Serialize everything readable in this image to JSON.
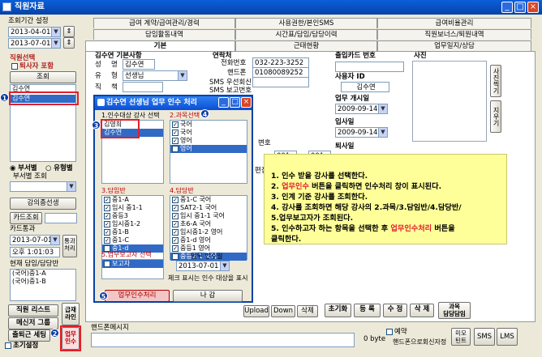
{
  "window": {
    "title": "직원자료",
    "controls": [
      "_",
      "□",
      "×"
    ]
  },
  "left": {
    "period_label": "조회기간 설정",
    "date_from": "2013-04-01",
    "date_to": "2013-07-01",
    "staff_select_label": "직원선택",
    "retired_label": "퇴사자 포함",
    "search_button": "조회",
    "names": [
      "김수연",
      "김수연"
    ],
    "radio_dept": "부서별",
    "radio_type": "유형별",
    "dept_search_label": "부서별 조회",
    "lecture_teacher_button": "강의종선생",
    "card_search_button": "카드조회",
    "card_pass_label": "카드통과",
    "card_date": "2013-07-01",
    "card_time": "오후 1:01:03",
    "pass_button": "통과처리",
    "current_class_label": "현재 담임/담당반",
    "current_classes": [
      "(국어)중1-A",
      "(국어)중1-B"
    ],
    "staff_list_button": "직원 리스트",
    "messenger_button": "메신저 그룹",
    "attendance_button": "출퇴근 세팅",
    "retirement_checkbox": "초기설정",
    "payroll_button": "급재라인",
    "handover_button": "업무인수"
  },
  "tabs": {
    "row1": [
      "급여 계약/급여관리/경력",
      "사용권한/본인SMS",
      "급여비율관리"
    ],
    "row2": [
      "담임활동내역",
      "시간표/담임/담당이력",
      "직원보너스/퇴원내역"
    ],
    "row3": [
      "기본",
      "근태현황",
      "업무일지/상담"
    ]
  },
  "basic": {
    "section_title": "김수연 기본사항",
    "name_label": "성",
    "name_label2": "명",
    "name_value": "김수연",
    "type_label": "유",
    "type_label2": "형",
    "type_value": "선생님",
    "position_label": "직",
    "position_label2": "책"
  },
  "contact": {
    "title": "연락처",
    "phone_label": "전화번호",
    "phone_value": "032-223-3252",
    "mobile_label": "핸드폰",
    "mobile_value": "01080089252",
    "sms1_label": "SMS 우선회신",
    "sms2_label": "SMS 보고번호",
    "zip_label": "변호",
    "num1": "001",
    "num2": "001",
    "partial_label": "편집"
  },
  "access": {
    "card_label": "출입카드 번호",
    "user_id_label": "사용자 ID",
    "user_id_value": "김수연",
    "start_label": "업무 개시일",
    "start_value": "2009-09-14",
    "join_label": "입사일",
    "join_value": "2009-09-14",
    "leave_label": "퇴사일",
    "photo_label": "사진",
    "photo_buttons": [
      "사진찍기",
      "지우기"
    ]
  },
  "dialog": {
    "title": "김수연 선생님 업무 인수 처리",
    "tab_teacher": "1.인수대상 강사 선택",
    "tab_subject": "2.과목선택",
    "teachers": [
      "김영희",
      "김수연"
    ],
    "subjects": [
      "국어",
      "국어",
      "영어",
      "영어"
    ],
    "class_section": "3.담임반",
    "classes": [
      "중1-A",
      "임시 중1-1",
      "중등3",
      "임시중1-2",
      "중1-B",
      "중1-C",
      "중1-d"
    ],
    "charge_section": "4.담당반",
    "charges": [
      "중1-C 국어",
      "SAT2-1 국어",
      "임시 중1-1 국어",
      "초6-A 국어",
      "임시중1-2 영어",
      "중1-d 영어",
      "중등1 영어",
      "중등2-1 국어"
    ],
    "report_section": "5.업무보고자 선택",
    "reporter": "보고자",
    "handover_date_label": "업무 인수일",
    "handover_date": "2013-07-01",
    "hint": "체크 표시는 인수 대상을 표시",
    "process_button": "업무인수처리",
    "close_button": "나 감"
  },
  "badges": [
    "1",
    "2",
    "3",
    "4",
    "5"
  ],
  "bottom": {
    "upload": "Upload",
    "down": "Down",
    "delete": "삭제",
    "reset": "초기화",
    "register": "등 록",
    "edit": "수 정",
    "remove": "삭 제",
    "subject_button": "과목\n담당담임",
    "mobile_msg_label": "핸드폰메시지",
    "bytes": "0 byte",
    "reserve_label": "예약",
    "send_to_mobile": "핸드폰으로회신자정",
    "mimo": "미모\n틴트",
    "sms": "SMS",
    "lms": "LMS"
  },
  "instructions": [
    "1. 인수 받을 강사를 선택한다.",
    "2. 업무인수 버튼을 클릭하면 인수처리 창이 표시된다.",
    "3. 인계 기준 강사를 조회한다.",
    "4. 강사를 조회하면 해당 강사의 2.과목/3.담임반/4.담당반/",
    "   5.업무보고자가 조회된다.",
    "5. 인수하고자 하는 항목을 선택한 후 업무인수처리 버튼을",
    "   클릭한다."
  ],
  "colors": {
    "accent": "#0842a8",
    "highlight": "#e0202a",
    "note_bg": "#ffff99"
  }
}
